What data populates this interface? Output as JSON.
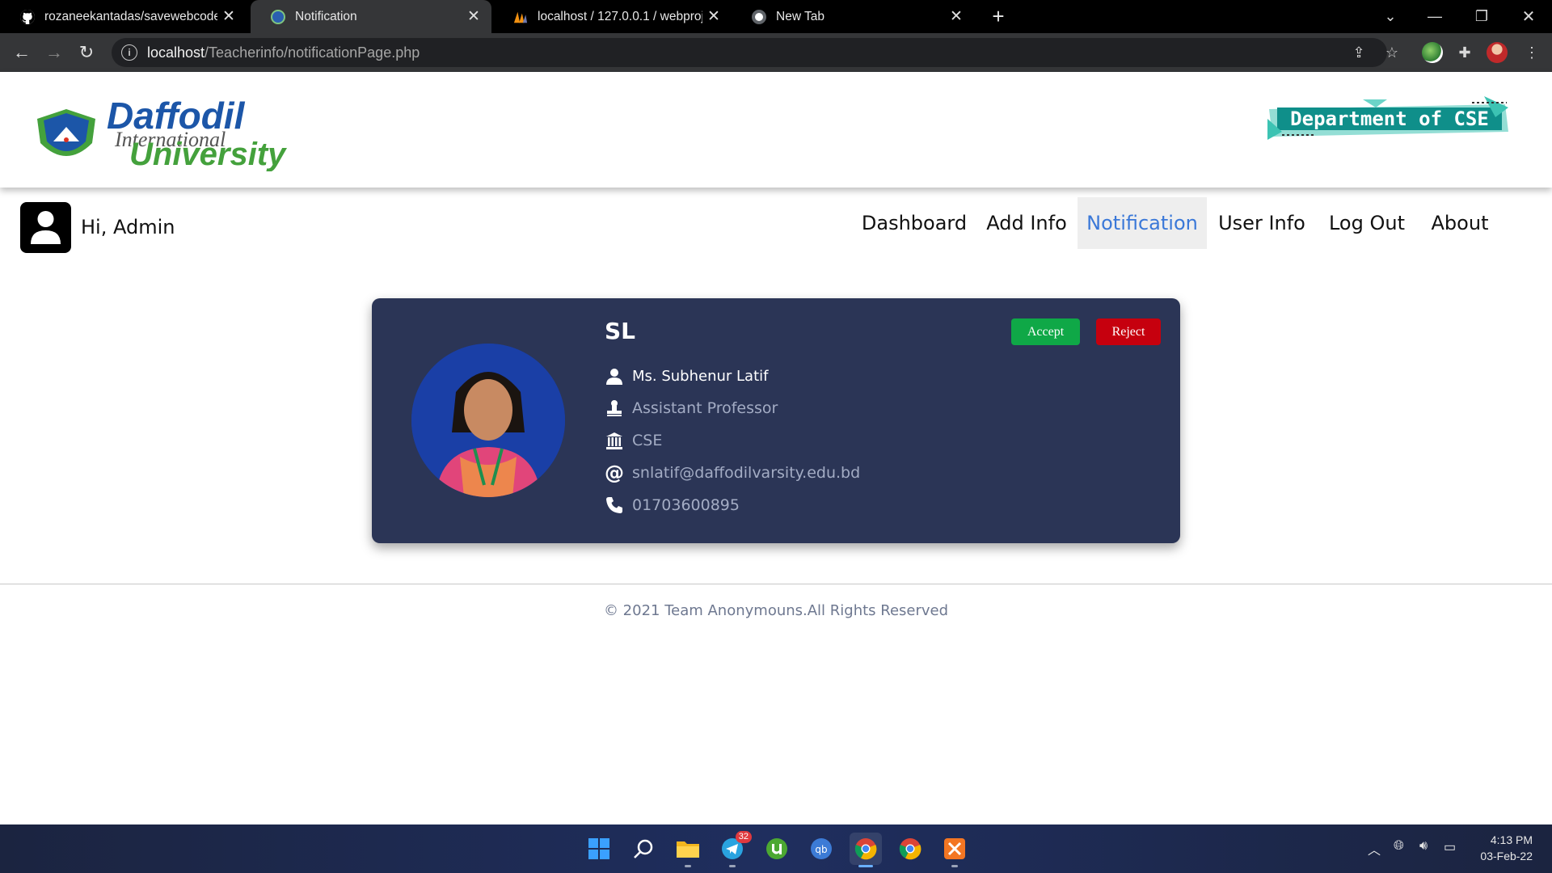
{
  "browser": {
    "tabs": [
      {
        "title": "rozaneekantadas/savewebcode",
        "active": false
      },
      {
        "title": "Notification",
        "active": true
      },
      {
        "title": "localhost / 127.0.0.1 / webproject",
        "active": false
      },
      {
        "title": "New Tab",
        "active": false
      }
    ],
    "address": {
      "host": "localhost",
      "path": "/Teacherinfo/notificationPage.php"
    }
  },
  "header": {
    "logo_text": {
      "line1": "Daffodil",
      "line2": "International",
      "line3": "University"
    },
    "dept_banner": "Department of CSE"
  },
  "userbar": {
    "greeting": "Hi, Admin"
  },
  "nav": {
    "items": [
      "Dashboard",
      "Add Info",
      "Notification",
      "User Info",
      "Log Out",
      "About"
    ],
    "active": "Notification"
  },
  "card": {
    "short_code": "SL",
    "accept_label": "Accept",
    "reject_label": "Reject",
    "name": "Ms. Subhenur Latif",
    "designation": "Assistant Professor",
    "department": "CSE",
    "email": "snlatif@daffodilvarsity.edu.bd",
    "phone": "01703600895",
    "colors": {
      "card_bg": "#2b3556",
      "accept": "#0fa847",
      "reject": "#c6000e"
    }
  },
  "footer": {
    "text": "© 2021 Team Anonymouns.All Rights Reserved"
  },
  "taskbar": {
    "telegram_badge": "32",
    "time": "4:13 PM",
    "date": "03-Feb-22"
  }
}
